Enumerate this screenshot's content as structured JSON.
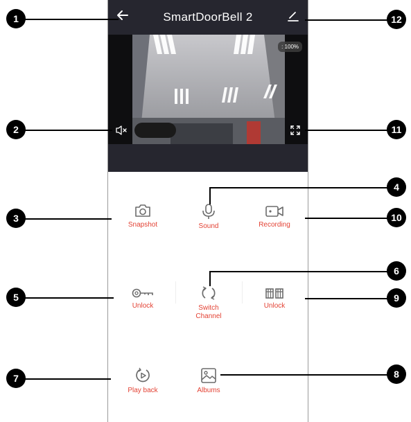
{
  "header": {
    "title": "SmartDoorBell 2",
    "back_icon": "arrow-left-icon",
    "edit_icon": "pencil-icon"
  },
  "video": {
    "zoom": ": 100%",
    "mute_icon": "speaker-mute-icon",
    "fullscreen_icon": "fullscreen-icon"
  },
  "controls": {
    "snapshot": "Snapshot",
    "sound": "Sound",
    "recording": "Recording",
    "unlock_1": "Unlock",
    "switch_channel_1": "Switch",
    "switch_channel_2": "Channel",
    "unlock_2": "Unlock",
    "playback": "Play back",
    "albums": "Albums"
  },
  "callouts": [
    "1",
    "2",
    "3",
    "4",
    "5",
    "6",
    "7",
    "8",
    "9",
    "10",
    "11",
    "12"
  ],
  "colors": {
    "header_bg": "#26262f",
    "label_red": "#e34234",
    "icon_gray": "#6b6b6b"
  }
}
